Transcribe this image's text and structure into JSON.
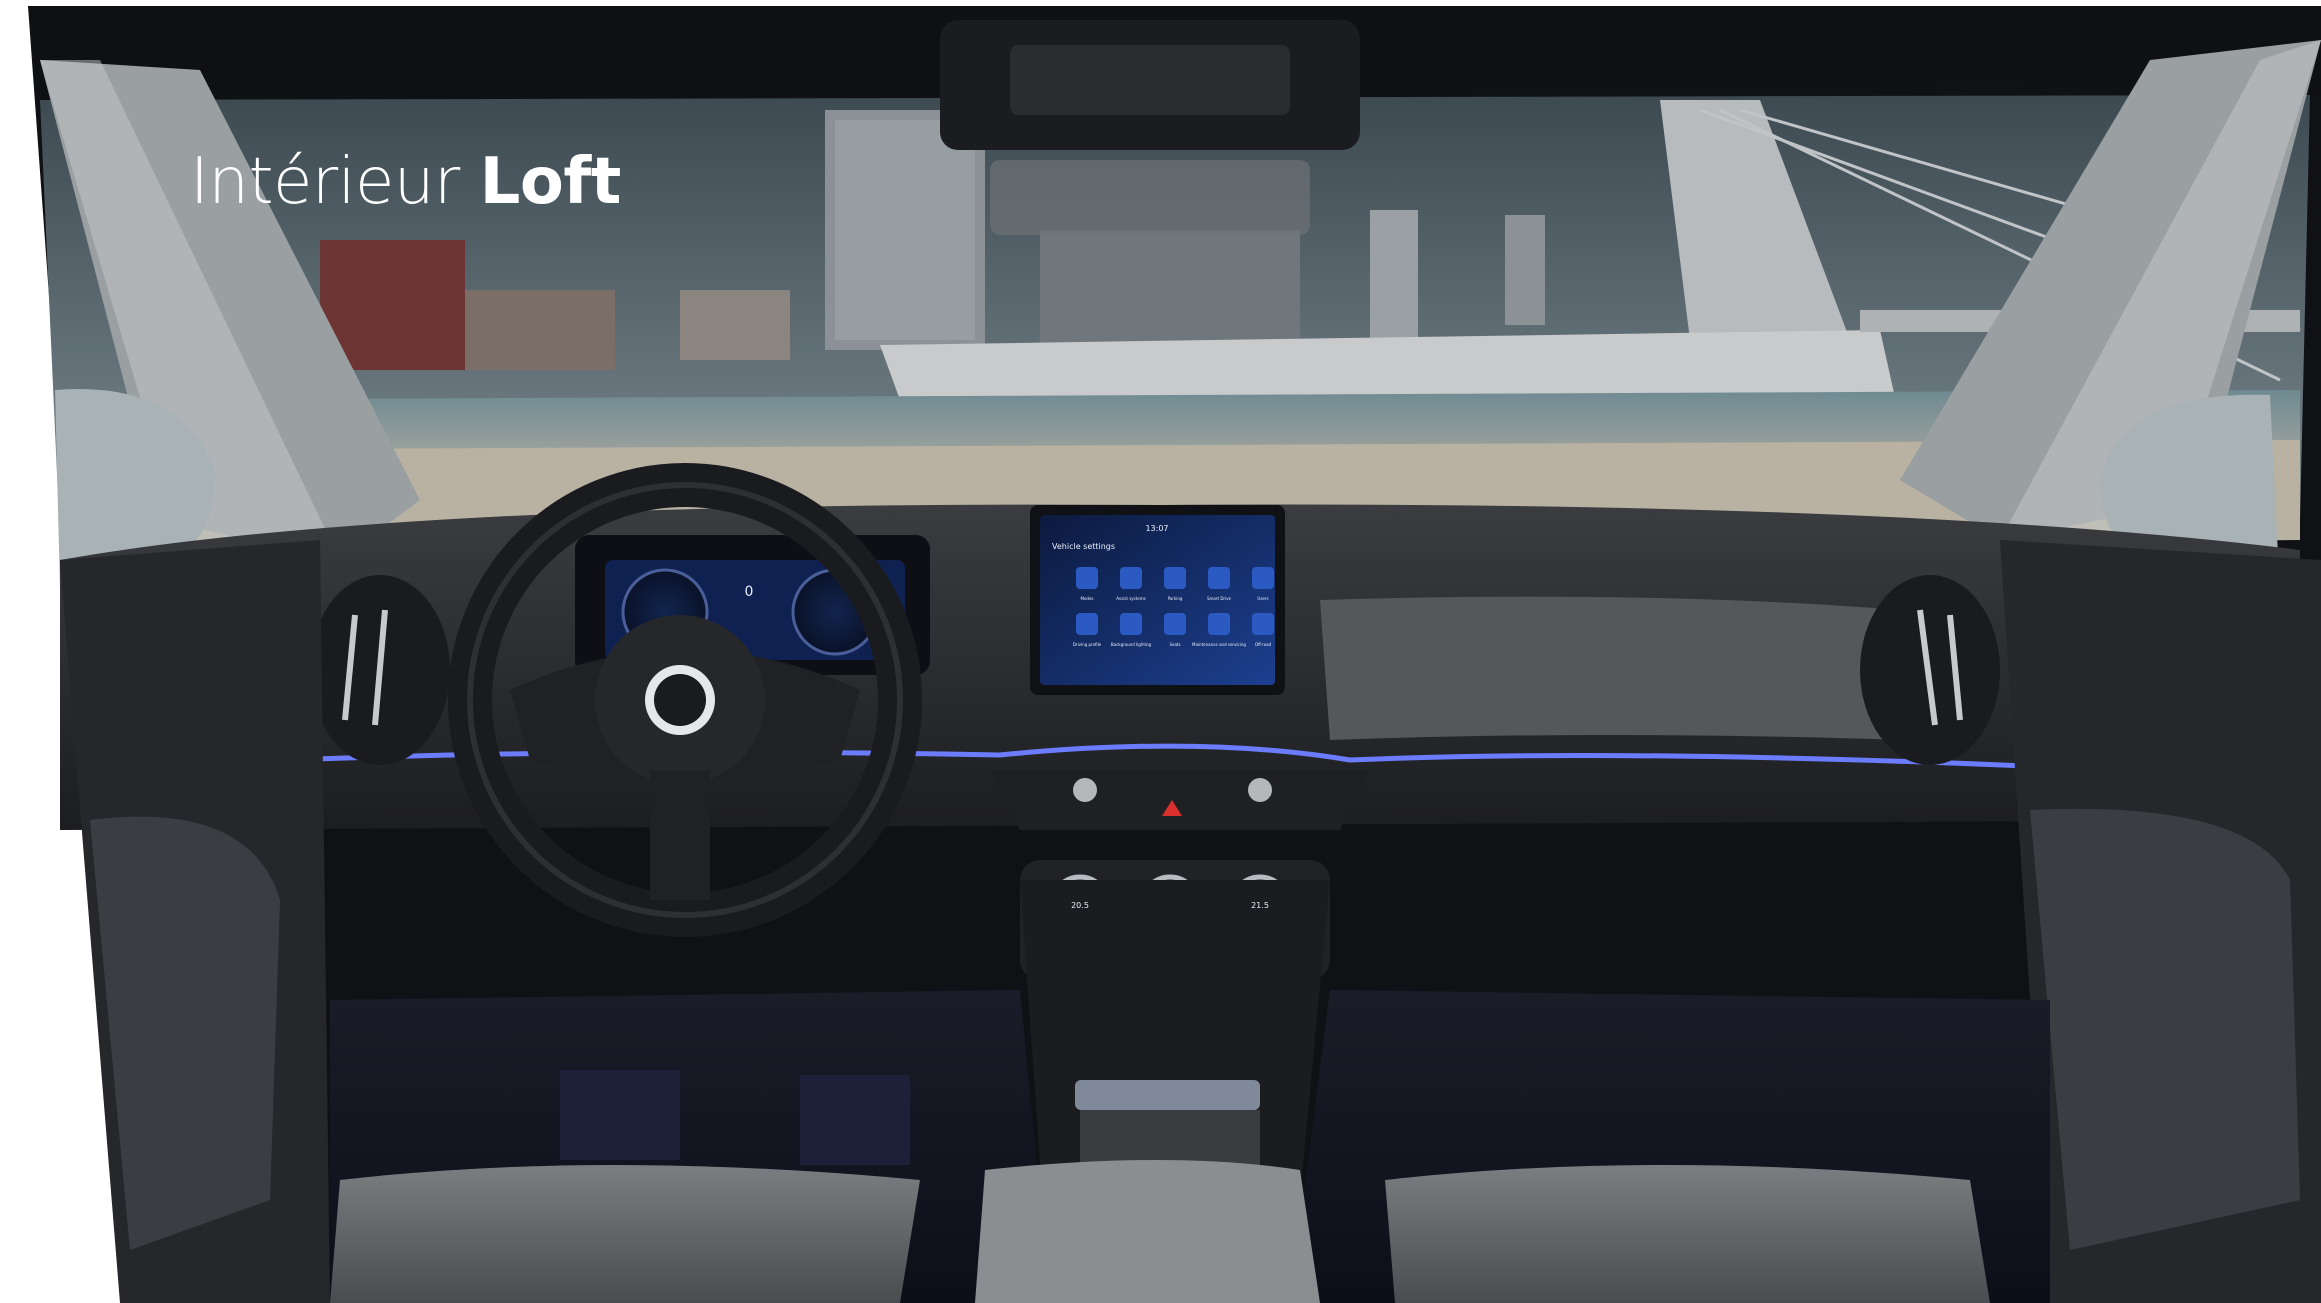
{
  "title": {
    "prefix": "Intérieur ",
    "emphasis": "Loft"
  },
  "infotainment": {
    "clock": "13:07",
    "heading": "Vehicle settings",
    "tiles": [
      "Modes",
      "Assist systems",
      "Parking",
      "Smart Drive",
      "Users",
      "Driving profile",
      "Background lighting",
      "Seats",
      "Maintenance and servicing",
      "Off-road"
    ]
  },
  "instrument_cluster": {
    "speed": "0"
  },
  "climate": {
    "driver_temp": "20.5",
    "passenger_temp": "21.5"
  },
  "colors": {
    "ambient_light": "#6b7cff",
    "screen_blue": "#1c3f8f",
    "dashboard": "#2b2d31",
    "sky": "#596670"
  }
}
